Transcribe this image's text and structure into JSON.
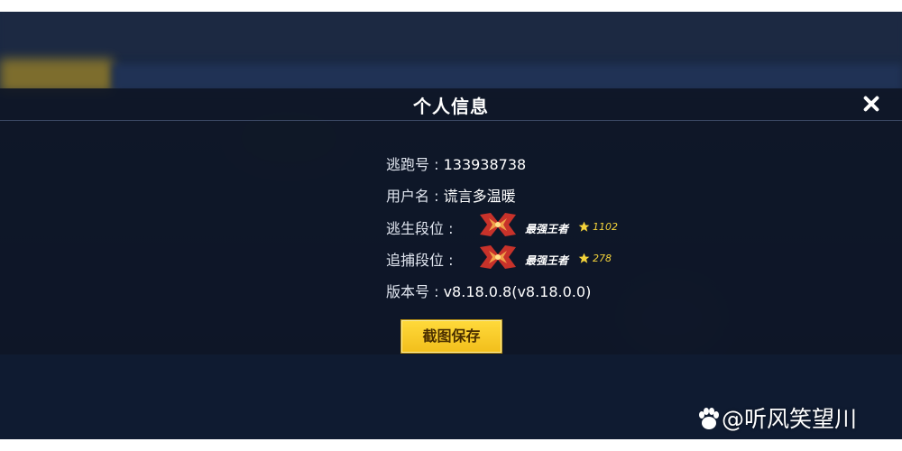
{
  "dialog": {
    "title": "个人信息",
    "close_icon": "close-icon"
  },
  "info": {
    "escape_id_label": "逃跑号 : ",
    "escape_id_value": "133938738",
    "username_label": "用户名 : ",
    "username_value": "谎言多温暖",
    "escape_rank_label": "逃生段位 :",
    "escape_rank_name": "最强王者",
    "escape_rank_score": "1102",
    "chase_rank_label": "追捕段位 :",
    "chase_rank_name": "最强王者",
    "chase_rank_score": "278",
    "version_label": "版本号 : ",
    "version_value": "v8.18.0.8(v8.18.0.0)"
  },
  "buttons": {
    "screenshot_save": "截图保存"
  },
  "watermark": {
    "text": "@听风笑望川",
    "icon": "paw-icon"
  },
  "colors": {
    "accent_button": "#f2bf1c",
    "rank_score": "#f3d23a",
    "panel_bg": "#0e1626"
  }
}
